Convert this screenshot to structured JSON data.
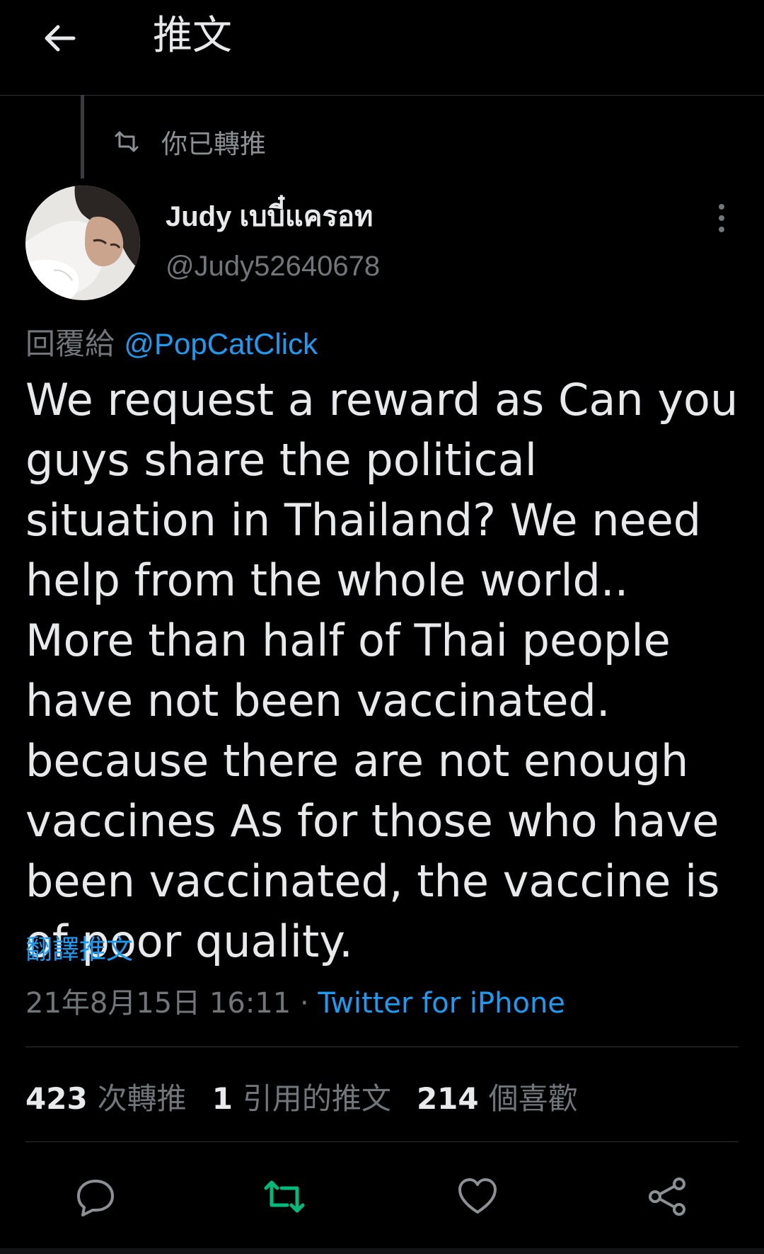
{
  "header": {
    "title": "推文",
    "back_icon": "arrow-left-icon"
  },
  "retweet_indicator": {
    "icon": "retweet-icon",
    "label": "你已轉推"
  },
  "author": {
    "display_name": "Judy เบบี๋แครอท",
    "handle": "@Judy52640678",
    "avatar": "profile-photo"
  },
  "reply": {
    "prefix": "回覆給",
    "mention": "@PopCatClick"
  },
  "tweet": {
    "text": "We request a reward as Can you guys share the political situation in Thailand? We need help from the whole world.. More than half of Thai people have not been vaccinated. because there are not enough vaccines As for those who have been vaccinated, the vaccine is of poor quality.",
    "translate_label": "翻譯推文",
    "timestamp": "21年8月15日 16:11",
    "separator": "·",
    "source": "Twitter for iPhone"
  },
  "stats": {
    "retweets": {
      "count": "423",
      "label": "次轉推"
    },
    "quotes": {
      "count": "1",
      "label": "引用的推文"
    },
    "likes": {
      "count": "214",
      "label": "個喜歡"
    }
  },
  "actions": [
    {
      "name": "reply",
      "icon": "reply-icon"
    },
    {
      "name": "retweet",
      "icon": "retweet-icon",
      "active": true
    },
    {
      "name": "like",
      "icon": "heart-icon"
    },
    {
      "name": "share",
      "icon": "share-icon"
    }
  ],
  "colors": {
    "background": "#000000",
    "text": "#e7e9ea",
    "secondary": "#71767b",
    "link": "#1d9bf0",
    "retweet_active": "#00ba7c",
    "divider": "#2f3336"
  }
}
